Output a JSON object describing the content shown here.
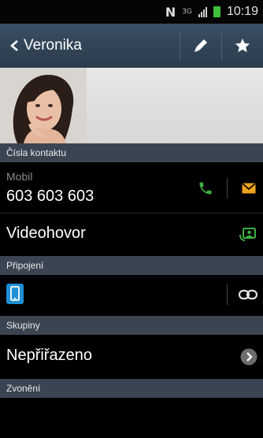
{
  "status_bar": {
    "time": "10:19",
    "network": "3G"
  },
  "header": {
    "contact_name": "Veronika"
  },
  "sections": {
    "contact_numbers": "Čísla kontaktu",
    "connection": "Připojení",
    "groups": "Skupiny",
    "ringtone": "Zvonění"
  },
  "phone": {
    "label": "Mobil",
    "number": "603 603 603"
  },
  "video_call": {
    "label": "Videohovor"
  },
  "groups": {
    "value": "Nepřiřazeno"
  },
  "colors": {
    "accent_green": "#3cb043",
    "message_orange": "#f0a41e",
    "header_bg": "#34485b",
    "section_bg": "#3b4552"
  }
}
